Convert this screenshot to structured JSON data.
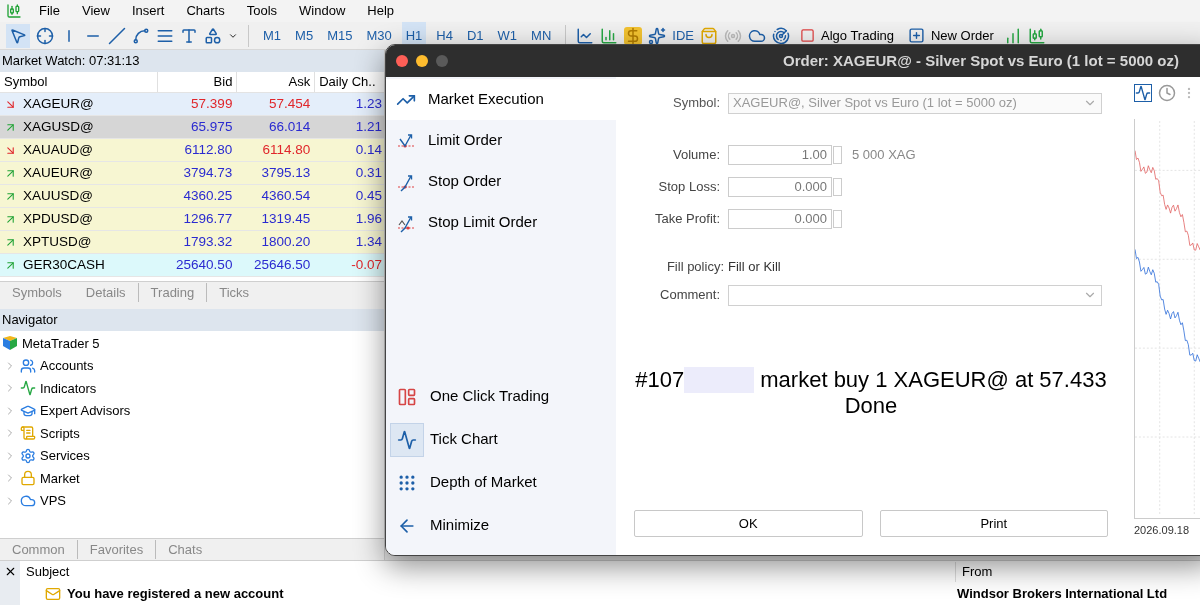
{
  "menu": [
    "File",
    "View",
    "Insert",
    "Charts",
    "Tools",
    "Window",
    "Help"
  ],
  "toolbar": {
    "timeframes": [
      {
        "label": "M1",
        "selected": false
      },
      {
        "label": "M5",
        "selected": false
      },
      {
        "label": "M15",
        "selected": false
      },
      {
        "label": "M30",
        "selected": false
      },
      {
        "label": "H1",
        "selected": true
      },
      {
        "label": "H4",
        "selected": false
      },
      {
        "label": "D1",
        "selected": false
      },
      {
        "label": "W1",
        "selected": false
      },
      {
        "label": "MN",
        "selected": false
      }
    ],
    "ide": "IDE",
    "algo_trading": "Algo Trading",
    "new_order": "New Order"
  },
  "market_watch": {
    "title": "Market Watch: 07:31:13",
    "columns": [
      "Symbol",
      "Bid",
      "Ask",
      "Daily Ch.."
    ],
    "rows": [
      {
        "symbol": "XAGEUR@",
        "falling": true,
        "bid": "57.399",
        "bid_down": true,
        "ask": "57.454",
        "ask_down": true,
        "change": "1.23",
        "change_down": false,
        "color": "#e4eefa"
      },
      {
        "symbol": "XAGUSD@",
        "falling": false,
        "bid": "65.975",
        "bid_down": false,
        "ask": "66.014",
        "ask_down": false,
        "change": "1.21",
        "change_down": false,
        "color": "#d6d6d6"
      },
      {
        "symbol": "XAUAUD@",
        "falling": true,
        "bid": "6112.80",
        "bid_down": false,
        "ask": "6114.80",
        "ask_down": true,
        "change": "0.14",
        "change_down": false,
        "color": "#f7f6d2"
      },
      {
        "symbol": "XAUEUR@",
        "falling": false,
        "bid": "3794.73",
        "bid_down": false,
        "ask": "3795.13",
        "ask_down": false,
        "change": "0.31",
        "change_down": false,
        "color": "#f7f6d2"
      },
      {
        "symbol": "XAUUSD@",
        "falling": false,
        "bid": "4360.25",
        "bid_down": false,
        "ask": "4360.54",
        "ask_down": false,
        "change": "0.45",
        "change_down": false,
        "color": "#f7f6d2"
      },
      {
        "symbol": "XPDUSD@",
        "falling": false,
        "bid": "1296.77",
        "bid_down": false,
        "ask": "1319.45",
        "ask_down": false,
        "change": "1.96",
        "change_down": false,
        "color": "#f7f6d2"
      },
      {
        "symbol": "XPTUSD@",
        "falling": false,
        "bid": "1793.32",
        "bid_down": false,
        "ask": "1800.20",
        "ask_down": false,
        "change": "1.34",
        "change_down": false,
        "color": "#f7f6d2"
      },
      {
        "symbol": "GER30CASH",
        "falling": false,
        "bid": "25640.50",
        "bid_down": false,
        "ask": "25646.50",
        "ask_down": false,
        "change": "-0.07",
        "change_down": true,
        "color": "#dcf9fb"
      }
    ],
    "tabs": [
      "Symbols",
      "Details",
      "Trading",
      "Ticks"
    ]
  },
  "navigator": {
    "title": "Navigator",
    "tree": [
      {
        "label": "MetaTrader 5",
        "kind": "root",
        "children": [
          {
            "label": "Accounts",
            "kind": "accounts"
          },
          {
            "label": "Indicators",
            "kind": "indicators"
          },
          {
            "label": "Expert Advisors",
            "kind": "experts"
          },
          {
            "label": "Scripts",
            "kind": "scripts"
          },
          {
            "label": "Services",
            "kind": "services"
          },
          {
            "label": "Market",
            "kind": "market"
          },
          {
            "label": "VPS",
            "kind": "vps"
          }
        ]
      }
    ],
    "tabs": [
      "Common",
      "Favorites",
      "Chats"
    ]
  },
  "order_dialog": {
    "title": "Order: XAGEUR@ - Silver Spot vs Euro (1 lot = 5000 oz)",
    "order_types": [
      {
        "label": "Market Execution",
        "kind": "market",
        "selected": true
      },
      {
        "label": "Limit Order",
        "kind": "limit",
        "selected": false
      },
      {
        "label": "Stop Order",
        "kind": "stop",
        "selected": false
      },
      {
        "label": "Stop Limit Order",
        "kind": "stop_limit",
        "selected": false
      }
    ],
    "tools": [
      {
        "label": "One Click Trading",
        "kind": "one_click",
        "on": false
      },
      {
        "label": "Tick Chart",
        "kind": "tick_chart",
        "on": true
      },
      {
        "label": "Depth of Market",
        "kind": "depth",
        "on": false
      },
      {
        "label": "Minimize",
        "kind": "minimize",
        "on": false
      }
    ],
    "form": {
      "symbol_label": "Symbol:",
      "symbol": "XAGEUR@, Silver Spot vs Euro (1 lot = 5000 oz)",
      "fields": [
        {
          "label": "Volume:",
          "value": "1.00",
          "note": "5 000 XAG"
        },
        {
          "label": "Stop Loss:",
          "value": "0.000"
        },
        {
          "label": "Take Profit:",
          "value": "0.000"
        }
      ],
      "fill_policy_label": "Fill policy:",
      "fill_policy": "Fill or Kill",
      "comment_label": "Comment:"
    },
    "result": {
      "prefix": "#107",
      "message": "market buy 1 XAGEUR@ at 57.433",
      "status": "Done"
    },
    "buttons": [
      "OK",
      "Print"
    ],
    "chart": {
      "date": "2026.09.18"
    }
  },
  "toolbox": {
    "columns": [
      "Subject",
      "From"
    ],
    "messages": [
      {
        "subject": "You have registered a new account",
        "from": "Windsor Brokers International Ltd"
      }
    ]
  }
}
